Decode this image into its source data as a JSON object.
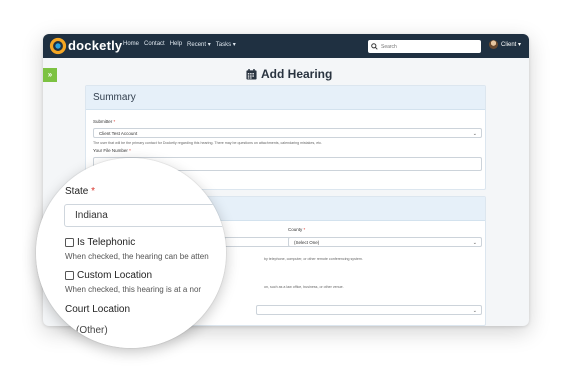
{
  "nav": {
    "brand": "docketly",
    "links": [
      "Home",
      "Contact",
      "Help",
      "Recent ▾",
      "Tasks ▾"
    ],
    "search_placeholder": "Search",
    "user": "Client ▾"
  },
  "page": {
    "title": "Add Hearing",
    "expand_label": "»"
  },
  "summary": {
    "heading": "Summary",
    "submitter_label": "Submitter",
    "submitter_value": "Client Test Account",
    "submitter_help": "The user that will be the primary contact for Docketly regarding this hearing. There may be questions on attachments, calendaring mistakes, etc.",
    "file_number_label": "Your File Number"
  },
  "location": {
    "county_label": "County",
    "county_value": "(Select One)",
    "telephonic_help_tail": "by telephone, computer, or other remote conferencing system.",
    "custom_help_tail": "on, such as a law office, business, or other venue."
  },
  "magnifier": {
    "state_label": "State",
    "state_value": "Indiana",
    "telephonic_label": "Is Telephonic",
    "telephonic_help": "When checked, the hearing can be atten",
    "custom_label": "Custom Location",
    "custom_help": "When checked, this hearing is at a nor",
    "court_location_label": "Court Location",
    "court_location_value": "(Other)"
  },
  "colors": {
    "navbar": "#1f3041",
    "accent_green": "#7cc242",
    "panel_header": "#e6f0f9",
    "required": "#d9332b"
  }
}
